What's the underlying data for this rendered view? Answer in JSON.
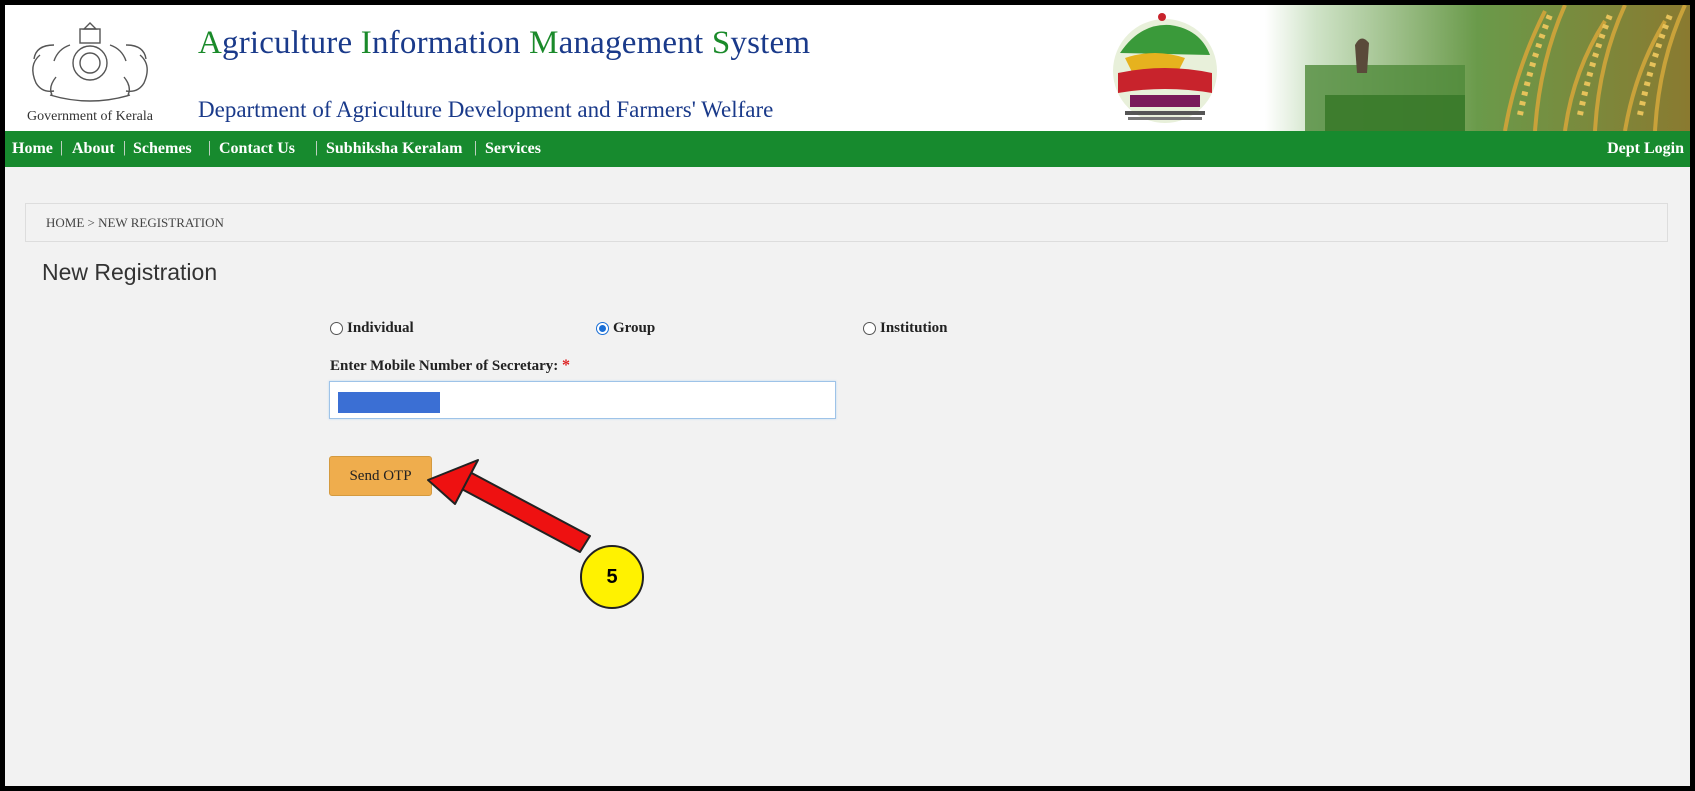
{
  "header": {
    "emblem_caption": "Government of Kerala",
    "title_parts": [
      {
        "text": "A",
        "accent": true
      },
      {
        "text": "griculture ",
        "accent": false
      },
      {
        "text": "I",
        "accent": true
      },
      {
        "text": "nformation ",
        "accent": false
      },
      {
        "text": "M",
        "accent": true
      },
      {
        "text": "anagement ",
        "accent": false
      },
      {
        "text": "S",
        "accent": true
      },
      {
        "text": "ystem",
        "accent": false
      }
    ],
    "subtitle": "Department of Agriculture Development and Farmers' Welfare",
    "logo_icon": "subhiksha-keralam-logo",
    "banner_icon": "paddy-field-banner"
  },
  "nav": {
    "items": [
      "Home",
      "About",
      "Schemes",
      "Contact Us",
      "Subhiksha Keralam",
      "Services"
    ],
    "separator": "|",
    "login": "Dept Login"
  },
  "breadcrumb": "HOME >  NEW REGISTRATION",
  "page_title": "New Registration",
  "form": {
    "options": [
      {
        "label": "Individual",
        "selected": false
      },
      {
        "label": "Group",
        "selected": true
      },
      {
        "label": "Institution",
        "selected": false
      }
    ],
    "mobile_label": "Enter Mobile Number of Secretary:",
    "required_mark": "*",
    "mobile_value": "",
    "send_otp_label": "Send OTP"
  },
  "annotation": {
    "step": "5"
  },
  "colors": {
    "nav_bg": "#178a2e",
    "title_blue": "#1a3a8a",
    "title_green": "#1a8a2a",
    "button": "#efad4d",
    "arrow": "#ee1111",
    "badge": "#fff200"
  }
}
